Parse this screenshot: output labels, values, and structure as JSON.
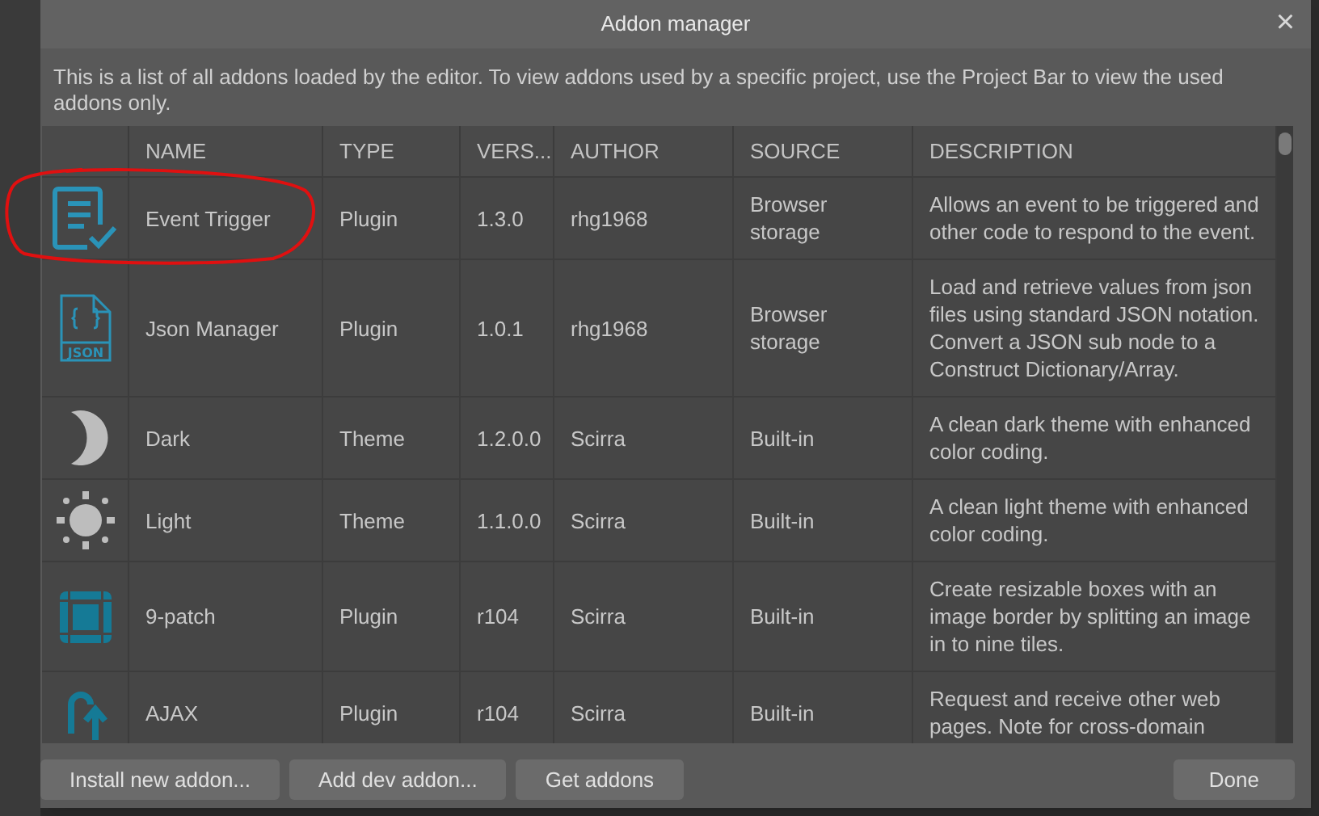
{
  "dialog": {
    "title": "Addon manager",
    "close": "×",
    "intro": "This is a list of all addons loaded by the editor. To view addons used by a specific project, use the Project Bar to view the used addons only."
  },
  "table": {
    "columns": [
      "NAME",
      "TYPE",
      "VERS...",
      "AUTHOR",
      "SOURCE",
      "DESCRIPTION"
    ],
    "rows": [
      {
        "kind": "checklist",
        "circled": true,
        "name": "Event Trigger",
        "type": "Plugin",
        "version": "1.3.0",
        "author": "rhg1968",
        "source": "Browser storage",
        "description": "Allows an event to be triggered and other code to respond to the event."
      },
      {
        "kind": "json",
        "icon_label": "JSON",
        "circled": false,
        "name": "Json Manager",
        "type": "Plugin",
        "version": "1.0.1",
        "author": "rhg1968",
        "source": "Browser storage",
        "description": "Load and retrieve values from json files using standard JSON notation. Convert a JSON sub node to a Construct Dictionary/Array."
      },
      {
        "kind": "moon",
        "circled": false,
        "name": "Dark",
        "type": "Theme",
        "version": "1.2.0.0",
        "author": "Scirra",
        "source": "Built-in",
        "description": "A clean dark theme with enhanced color coding."
      },
      {
        "kind": "sun",
        "circled": false,
        "name": "Light",
        "type": "Theme",
        "version": "1.1.0.0",
        "author": "Scirra",
        "source": "Built-in",
        "description": "A clean light theme with enhanced color coding."
      },
      {
        "kind": "ninepatch",
        "circled": false,
        "name": "9-patch",
        "type": "Plugin",
        "version": "r104",
        "author": "Scirra",
        "source": "Built-in",
        "description": "Create resizable boxes with an image border by splitting an image in to nine tiles."
      },
      {
        "kind": "ajax",
        "circled": false,
        "name": "AJAX",
        "type": "Plugin",
        "version": "r104",
        "author": "Scirra",
        "source": "Built-in",
        "description": "Request and receive other web pages. Note for cross-domain"
      }
    ]
  },
  "buttons": [
    "Install new addon...",
    "Add dev addon...",
    "Get addons"
  ],
  "done_button": "Done"
}
